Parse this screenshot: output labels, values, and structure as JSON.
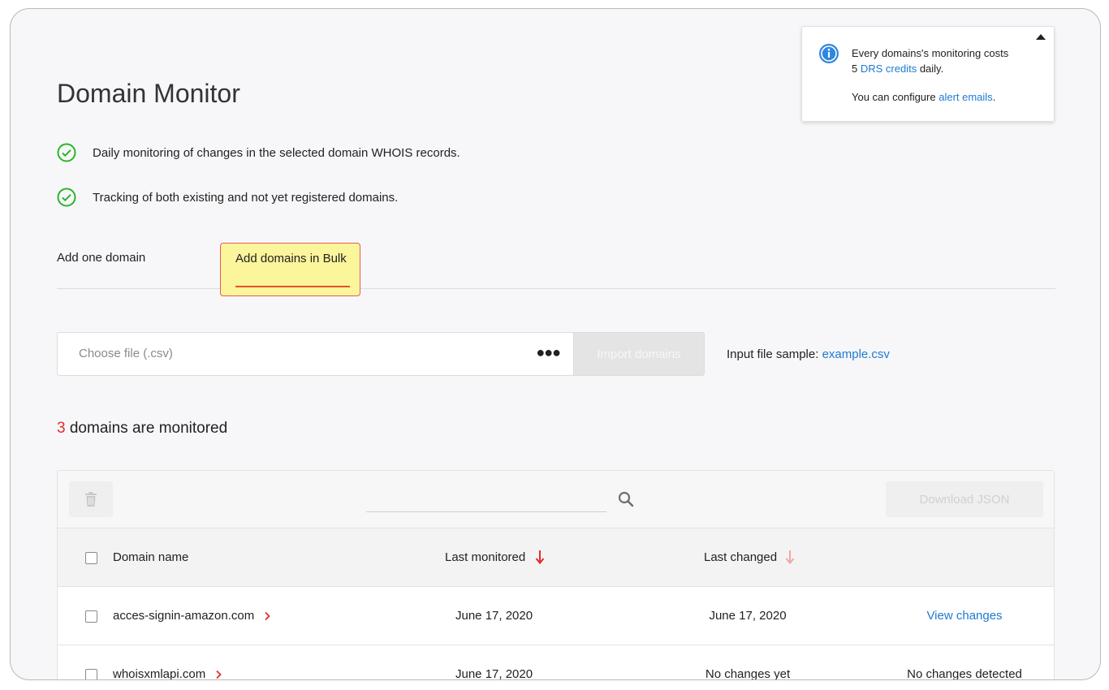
{
  "page": {
    "title": "Domain Monitor",
    "features": [
      "Daily monitoring of changes in the selected domain WHOIS records.",
      "Tracking of both existing and not yet registered domains."
    ]
  },
  "info": {
    "line1": "Every domains's monitoring costs",
    "line2_prefix": "5 ",
    "line2_link": "DRS credits",
    "line2_suffix": " daily.",
    "line3_prefix": "You can configure ",
    "line3_link": "alert emails",
    "line3_suffix": "."
  },
  "tabs": [
    {
      "label": "Add one domain",
      "active": false
    },
    {
      "label": "Add domains in Bulk",
      "active": true
    }
  ],
  "upload": {
    "placeholder": "Choose file (.csv)",
    "browse_icon": "more-dots-icon",
    "import_label": "Import domains",
    "sample_label": "Input file sample: ",
    "sample_link": "example.csv"
  },
  "summary": {
    "count": "3",
    "text": " domains are monitored"
  },
  "table": {
    "search_placeholder": "",
    "download_label": "Download JSON",
    "columns": {
      "domain": "Domain name",
      "last_monitored": "Last monitored",
      "last_changed": "Last changed"
    },
    "rows": [
      {
        "domain": "acces-signin-amazon.com",
        "last_monitored": "June 17, 2020",
        "last_changed": "June 17, 2020",
        "action": "View changes",
        "action_is_link": true
      },
      {
        "domain": "whoisxmlapi.com",
        "last_monitored": "June 17, 2020",
        "last_changed": "No changes yet",
        "action": "No changes detected",
        "action_is_link": false
      }
    ]
  },
  "colors": {
    "accent_link": "#1e7ad1",
    "success_check": "#2bb52b",
    "count_red": "#e32b2b",
    "tab_highlight": "#fbf59b",
    "tab_underline": "#e8502e"
  }
}
